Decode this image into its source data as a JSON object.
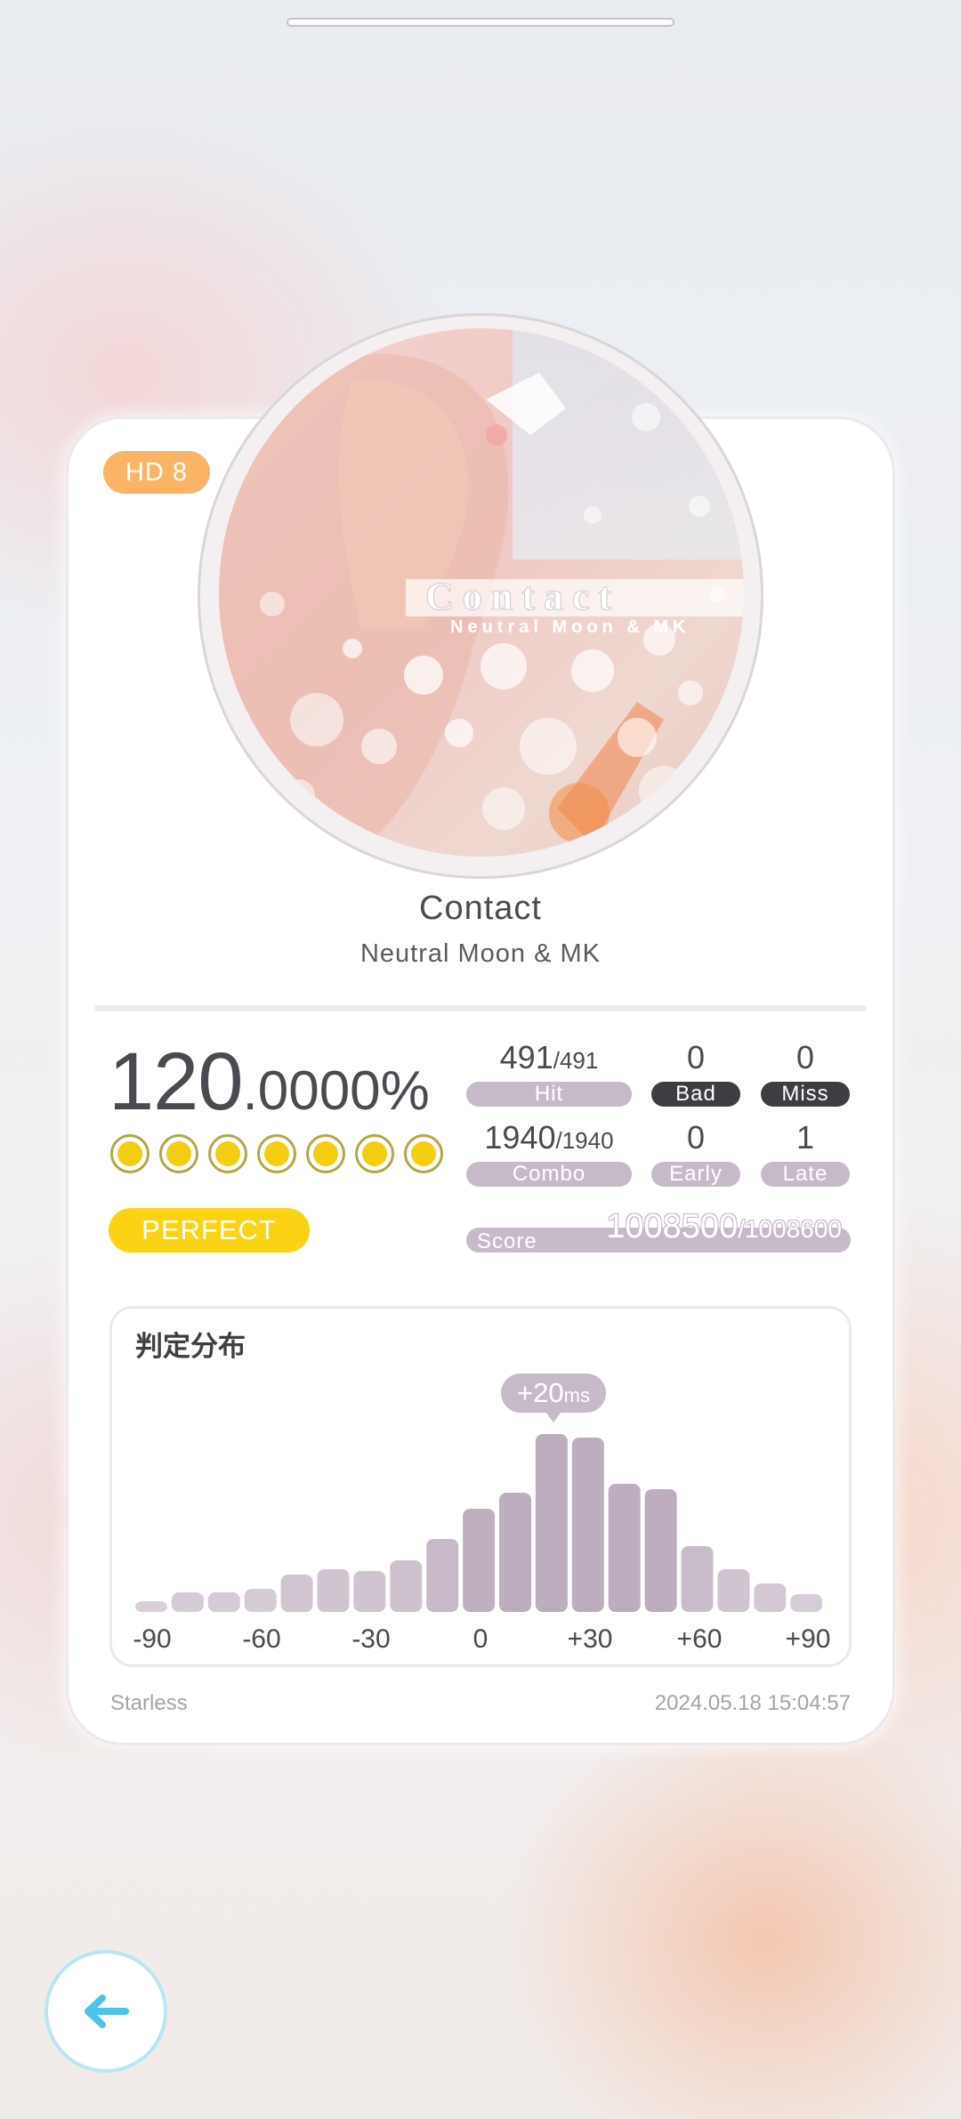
{
  "difficulty_badge": "HD  8",
  "song": {
    "title": "Contact",
    "artist": "Neutral Moon & MK"
  },
  "cover_art": {
    "overlay_title": "Contact",
    "overlay_artist": "Neutral Moon & MK"
  },
  "accuracy": {
    "int": "120",
    "dec": ".0000%"
  },
  "medal_count": 7,
  "rank_label": "PERFECT",
  "stats": {
    "hit": {
      "value": "491",
      "total": "/491",
      "label": "Hit"
    },
    "bad": {
      "value": "0",
      "label": "Bad"
    },
    "miss": {
      "value": "0",
      "label": "Miss"
    },
    "combo": {
      "value": "1940",
      "total": "/1940",
      "label": "Combo"
    },
    "early": {
      "value": "0",
      "label": "Early"
    },
    "late": {
      "value": "1",
      "label": "Late"
    },
    "score": {
      "label": "Score",
      "value": "1008500",
      "max": "/1008600"
    }
  },
  "distribution": {
    "title": "判定分布",
    "peak_value": "+20",
    "peak_unit": "ms",
    "x_labels": [
      "-90",
      "-60",
      "-30",
      "0",
      "+30",
      "+60",
      "+90"
    ],
    "bar_levels": [
      0.06,
      0.11,
      0.11,
      0.13,
      0.21,
      0.24,
      0.23,
      0.29,
      0.41,
      0.58,
      0.67,
      1.0,
      0.98,
      0.72,
      0.69,
      0.37,
      0.24,
      0.16,
      0.1
    ]
  },
  "footer": {
    "player": "Starless",
    "timestamp": "2024.05.18 15:04:57"
  },
  "colors": {
    "accent_purple": "#c7bac8",
    "gold": "#f4cc10",
    "badge_orange": "#fbb465",
    "back_blue": "#4cc3ec"
  },
  "icons": {
    "back": "arrow-left-icon"
  }
}
